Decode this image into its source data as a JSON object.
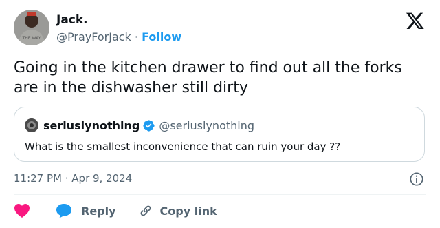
{
  "author": {
    "display_name": "Jack.",
    "handle": "@PrayForJack",
    "separator": "·",
    "follow_label": "Follow",
    "avatar_shirt_text": "THE WAY"
  },
  "tweet": {
    "text": "Going in the kitchen drawer to find out all the forks are in the dishwasher still dirty",
    "timestamp": "11:27 PM · Apr 9, 2024"
  },
  "quote": {
    "display_name": "seriuslynothing",
    "handle": "@seriuslynothing",
    "verified": true,
    "text": "What is the smallest inconvenience that can ruin your day ??"
  },
  "actions": {
    "reply_label": "Reply",
    "copy_link_label": "Copy link"
  },
  "colors": {
    "accent": "#1d9bf0",
    "heart": "#f91880",
    "text": "#0f1419",
    "secondary": "#536471",
    "border": "#cfd9de"
  },
  "icons": {
    "logo": "x-logo-icon",
    "verified": "verified-badge-icon",
    "info": "info-icon",
    "like": "heart-icon",
    "reply": "reply-bubble-icon",
    "copy_link": "link-icon"
  }
}
